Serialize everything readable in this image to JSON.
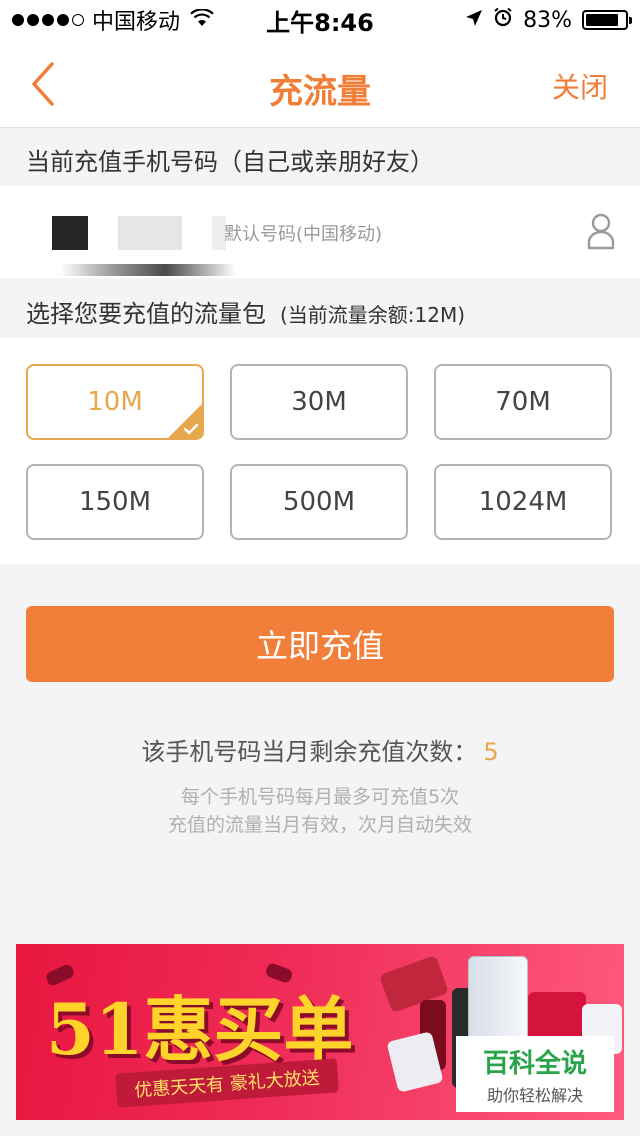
{
  "status_bar": {
    "carrier": "中国移动",
    "time": "上午8:46",
    "battery": "83%",
    "battery_level": 0.83,
    "signal_bars": 4,
    "signal_max": 5
  },
  "nav": {
    "back_icon": "chevron-left-icon",
    "title": "充流量",
    "close_label": "关闭"
  },
  "phone_section": {
    "label": "当前充值手机号码（自己或亲朋好友）",
    "placeholder": "默认号码(中国移动)",
    "contact_icon": "person-icon"
  },
  "package_section": {
    "label": "选择您要充值的流量包",
    "balance_note": "(当前流量余额:12M)",
    "packages": [
      "10M",
      "30M",
      "70M",
      "150M",
      "500M",
      "1024M"
    ],
    "selected_index": 0
  },
  "recharge_button": "立即充值",
  "remaining": {
    "label": "该手机号码当月剩余充值次数：",
    "count": "5"
  },
  "notes": [
    "每个手机号码每月最多可充值5次",
    "充值的流量当月有效，次月自动失效"
  ],
  "banner": {
    "headline": "51惠买单",
    "tagline": "优惠天天有 豪礼大放送"
  },
  "watermark": {
    "title": "百科全说",
    "subtitle": "助你轻松解决"
  },
  "colors": {
    "accent": "#f07e37",
    "selected": "#e7a74d",
    "button": "#f27f39"
  }
}
